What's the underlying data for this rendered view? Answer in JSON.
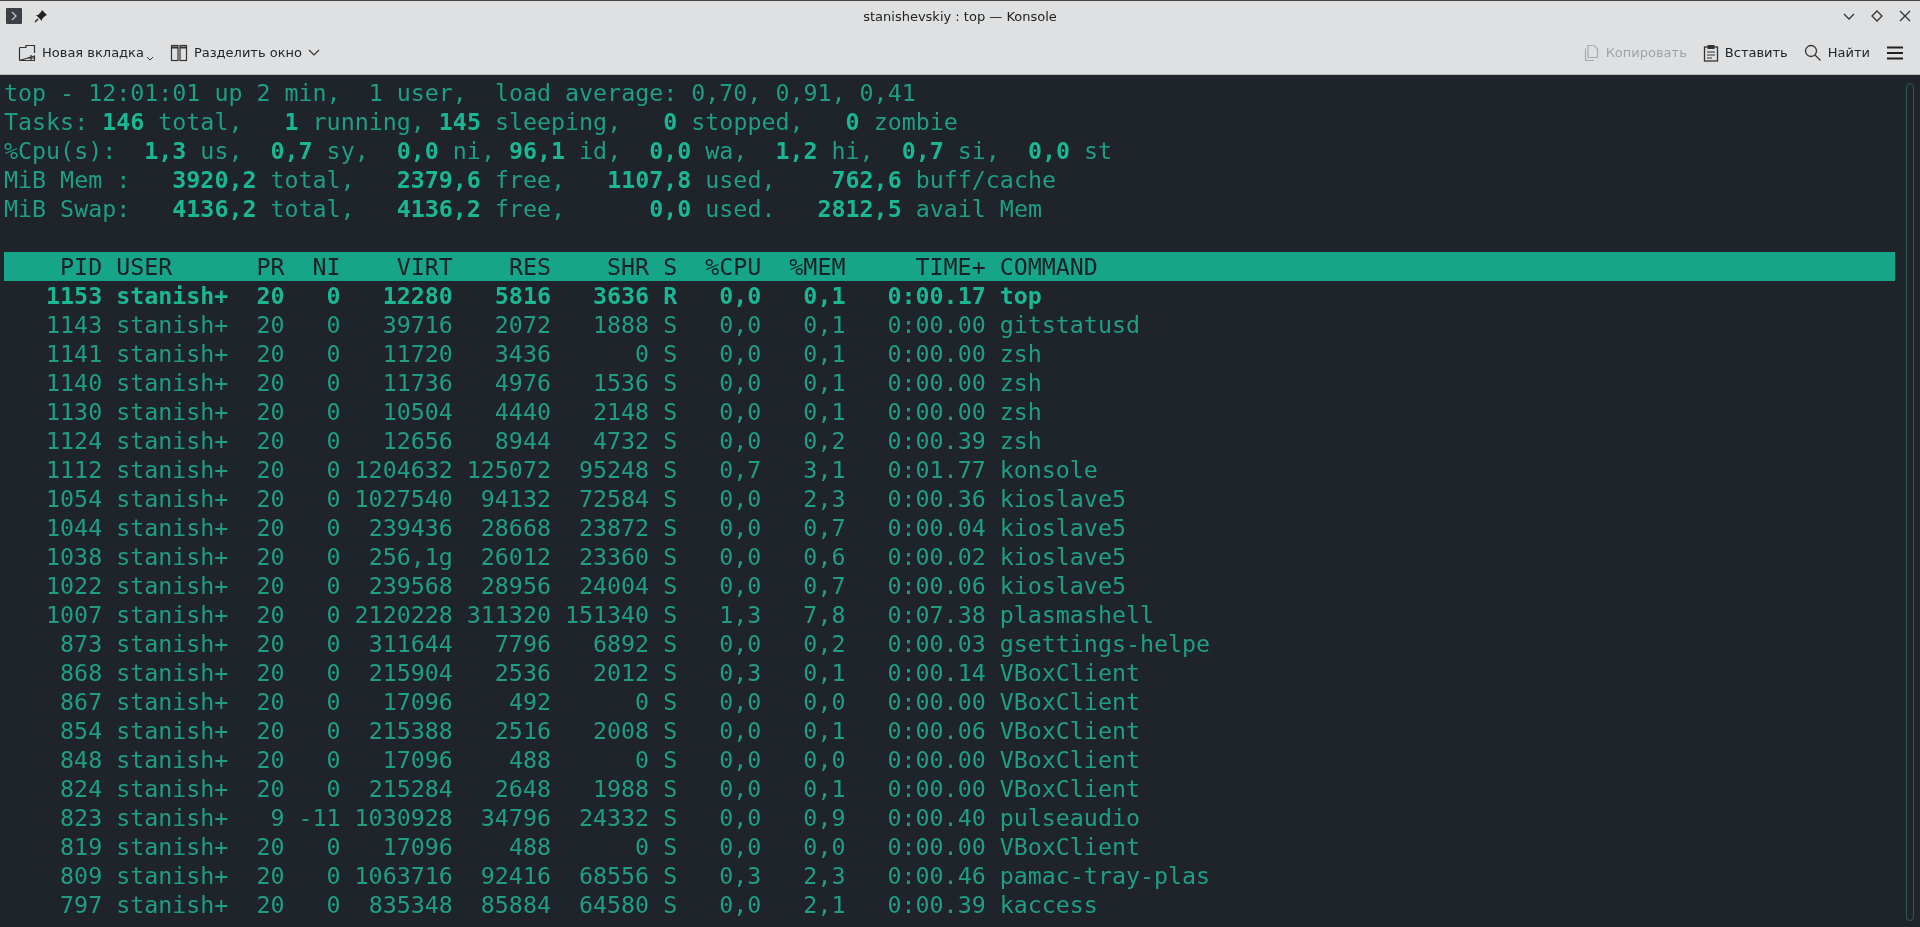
{
  "window": {
    "title": "stanishevskiy : top — Konsole"
  },
  "toolbar": {
    "left": [
      {
        "kind": "new-tab",
        "label": "Новая вкладка",
        "disabled": false
      },
      {
        "kind": "split",
        "label": "Разделить окно",
        "disabled": false
      }
    ],
    "right": [
      {
        "kind": "copy",
        "label": "Копировать",
        "disabled": true
      },
      {
        "kind": "paste",
        "label": "Вставить",
        "disabled": false
      },
      {
        "kind": "find",
        "label": "Найти",
        "disabled": false
      },
      {
        "kind": "menu"
      }
    ]
  },
  "summary": [
    "top - 12:01:01 up 2 min,  1 user,  load average: 0,70, 0,91, 0,41",
    "Tasks: **146** total,   **1** running, **145** sleeping,   **0** stopped,   **0** zombie",
    "%Cpu(s):  **1,3** us,  **0,7** sy,  **0,0** ni, **96,1** id,  **0,0** wa,  **1,2** hi,  **0,7** si,  **0,0** st",
    "MiB Mem :   **3920,2** total,   **2379,6** free,   **1107,8** used,    **762,6** buff/cache",
    "MiB Swap:   **4136,2** total,   **4136,2** free,      **0,0** used.   **2812,5** avail Mem"
  ],
  "table": {
    "columns": [
      "PID",
      "USER",
      "PR",
      "NI",
      "VIRT",
      "RES",
      "SHR",
      "S",
      "%CPU",
      "%MEM",
      "TIME+",
      "COMMAND"
    ],
    "rows": [
      {
        "cells": [
          "1153",
          "stanish+",
          "20",
          "0",
          "12280",
          "5816",
          "3636",
          "R",
          "0,0",
          "0,1",
          "0:00.17",
          "top"
        ],
        "bold": true
      },
      {
        "cells": [
          "1143",
          "stanish+",
          "20",
          "0",
          "39716",
          "2072",
          "1888",
          "S",
          "0,0",
          "0,1",
          "0:00.00",
          "gitstatusd"
        ],
        "bold": false
      },
      {
        "cells": [
          "1141",
          "stanish+",
          "20",
          "0",
          "11720",
          "3436",
          "0",
          "S",
          "0,0",
          "0,1",
          "0:00.00",
          "zsh"
        ],
        "bold": false
      },
      {
        "cells": [
          "1140",
          "stanish+",
          "20",
          "0",
          "11736",
          "4976",
          "1536",
          "S",
          "0,0",
          "0,1",
          "0:00.00",
          "zsh"
        ],
        "bold": false
      },
      {
        "cells": [
          "1130",
          "stanish+",
          "20",
          "0",
          "10504",
          "4440",
          "2148",
          "S",
          "0,0",
          "0,1",
          "0:00.00",
          "zsh"
        ],
        "bold": false
      },
      {
        "cells": [
          "1124",
          "stanish+",
          "20",
          "0",
          "12656",
          "8944",
          "4732",
          "S",
          "0,0",
          "0,2",
          "0:00.39",
          "zsh"
        ],
        "bold": false
      },
      {
        "cells": [
          "1112",
          "stanish+",
          "20",
          "0",
          "1204632",
          "125072",
          "95248",
          "S",
          "0,7",
          "3,1",
          "0:01.77",
          "konsole"
        ],
        "bold": false
      },
      {
        "cells": [
          "1054",
          "stanish+",
          "20",
          "0",
          "1027540",
          "94132",
          "72584",
          "S",
          "0,0",
          "2,3",
          "0:00.36",
          "kioslave5"
        ],
        "bold": false
      },
      {
        "cells": [
          "1044",
          "stanish+",
          "20",
          "0",
          "239436",
          "28668",
          "23872",
          "S",
          "0,0",
          "0,7",
          "0:00.04",
          "kioslave5"
        ],
        "bold": false
      },
      {
        "cells": [
          "1038",
          "stanish+",
          "20",
          "0",
          "256,1g",
          "26012",
          "23360",
          "S",
          "0,0",
          "0,6",
          "0:00.02",
          "kioslave5"
        ],
        "bold": false
      },
      {
        "cells": [
          "1022",
          "stanish+",
          "20",
          "0",
          "239568",
          "28956",
          "24004",
          "S",
          "0,0",
          "0,7",
          "0:00.06",
          "kioslave5"
        ],
        "bold": false
      },
      {
        "cells": [
          "1007",
          "stanish+",
          "20",
          "0",
          "2120228",
          "311320",
          "151340",
          "S",
          "1,3",
          "7,8",
          "0:07.38",
          "plasmashell"
        ],
        "bold": false
      },
      {
        "cells": [
          "873",
          "stanish+",
          "20",
          "0",
          "311644",
          "7796",
          "6892",
          "S",
          "0,0",
          "0,2",
          "0:00.03",
          "gsettings-helpe"
        ],
        "bold": false
      },
      {
        "cells": [
          "868",
          "stanish+",
          "20",
          "0",
          "215904",
          "2536",
          "2012",
          "S",
          "0,3",
          "0,1",
          "0:00.14",
          "VBoxClient"
        ],
        "bold": false
      },
      {
        "cells": [
          "867",
          "stanish+",
          "20",
          "0",
          "17096",
          "492",
          "0",
          "S",
          "0,0",
          "0,0",
          "0:00.00",
          "VBoxClient"
        ],
        "bold": false
      },
      {
        "cells": [
          "854",
          "stanish+",
          "20",
          "0",
          "215388",
          "2516",
          "2008",
          "S",
          "0,0",
          "0,1",
          "0:00.06",
          "VBoxClient"
        ],
        "bold": false
      },
      {
        "cells": [
          "848",
          "stanish+",
          "20",
          "0",
          "17096",
          "488",
          "0",
          "S",
          "0,0",
          "0,0",
          "0:00.00",
          "VBoxClient"
        ],
        "bold": false
      },
      {
        "cells": [
          "824",
          "stanish+",
          "20",
          "0",
          "215284",
          "2648",
          "1988",
          "S",
          "0,0",
          "0,1",
          "0:00.00",
          "VBoxClient"
        ],
        "bold": false
      },
      {
        "cells": [
          "823",
          "stanish+",
          "9",
          "-11",
          "1030928",
          "34796",
          "24332",
          "S",
          "0,0",
          "0,9",
          "0:00.40",
          "pulseaudio"
        ],
        "bold": false
      },
      {
        "cells": [
          "819",
          "stanish+",
          "20",
          "0",
          "17096",
          "488",
          "0",
          "S",
          "0,0",
          "0,0",
          "0:00.00",
          "VBoxClient"
        ],
        "bold": false
      },
      {
        "cells": [
          "809",
          "stanish+",
          "20",
          "0",
          "1063716",
          "92416",
          "68556",
          "S",
          "0,3",
          "2,3",
          "0:00.46",
          "pamac-tray-plas"
        ],
        "bold": false
      },
      {
        "cells": [
          "797",
          "stanish+",
          "20",
          "0",
          "835348",
          "85884",
          "64580",
          "S",
          "0,0",
          "2,1",
          "0:00.39",
          "kaccess"
        ],
        "bold": false
      }
    ]
  }
}
